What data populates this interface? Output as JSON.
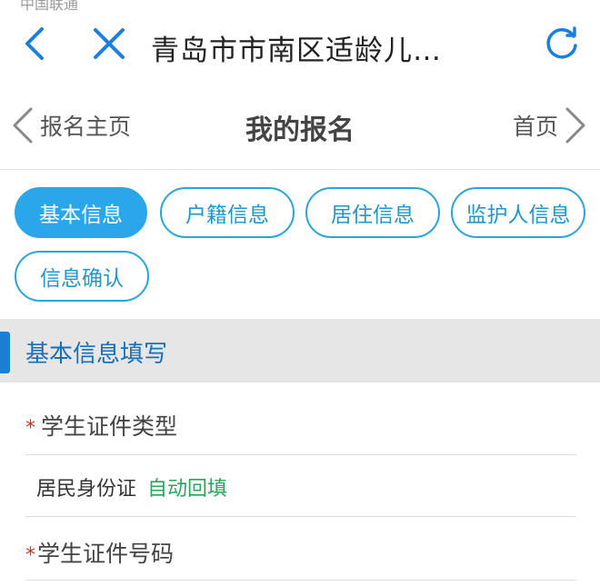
{
  "browser": {
    "status_cut": "中国联通",
    "title": "青岛市市南区适龄儿…"
  },
  "nav": {
    "back_label": "报名主页",
    "title": "我的报名",
    "home_label": "首页"
  },
  "tabs": [
    {
      "label": "基本信息",
      "active": true
    },
    {
      "label": "户籍信息",
      "active": false
    },
    {
      "label": "居住信息",
      "active": false
    },
    {
      "label": "监护人信息",
      "active": false
    },
    {
      "label": "信息确认",
      "active": false
    }
  ],
  "section": {
    "title": "基本信息填写"
  },
  "form": {
    "field1": {
      "required_mark": "*",
      "label": "学生证件类型",
      "value": "居民身份证",
      "hint": "自动回填"
    },
    "field2": {
      "required_mark": "*",
      "label": "学生证件号码"
    }
  },
  "colors": {
    "accent": "#2aa6ea",
    "tab_border": "#2aa6d6",
    "section_bar": "#1a7fd4",
    "section_title": "#1b6fb5",
    "required": "#d42b2b",
    "autofill": "#27a65a",
    "browser_icons": "#1a7fe0"
  },
  "icons": {
    "browser_back": "chevron-left-icon",
    "browser_close": "close-icon",
    "browser_refresh": "refresh-icon",
    "nav_back": "chevron-left-icon",
    "nav_home": "chevron-right-icon"
  }
}
